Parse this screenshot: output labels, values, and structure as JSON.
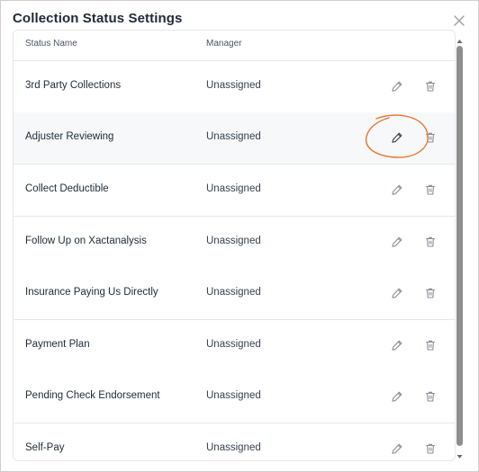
{
  "dialog": {
    "title": "Collection Status Settings"
  },
  "table": {
    "headers": {
      "status_name": "Status Name",
      "manager": "Manager"
    },
    "rows": [
      {
        "status_name": "3rd Party Collections",
        "manager": "Unassigned"
      },
      {
        "status_name": "Adjuster Reviewing",
        "manager": "Unassigned"
      },
      {
        "status_name": "Collect Deductible",
        "manager": "Unassigned"
      },
      {
        "status_name": "Follow Up on Xactanalysis",
        "manager": "Unassigned"
      },
      {
        "status_name": "Insurance Paying Us Directly",
        "manager": "Unassigned"
      },
      {
        "status_name": "Payment Plan",
        "manager": "Unassigned"
      },
      {
        "status_name": "Pending Check Endorsement",
        "manager": "Unassigned"
      },
      {
        "status_name": "Self-Pay",
        "manager": "Unassigned"
      }
    ]
  },
  "icons": {
    "close": "close-icon",
    "edit": "pencil-icon",
    "delete": "trash-icon"
  },
  "colors": {
    "annotation": "#e8742f",
    "hover_row": "#f7f8f9",
    "icon": "#8a8f98"
  }
}
